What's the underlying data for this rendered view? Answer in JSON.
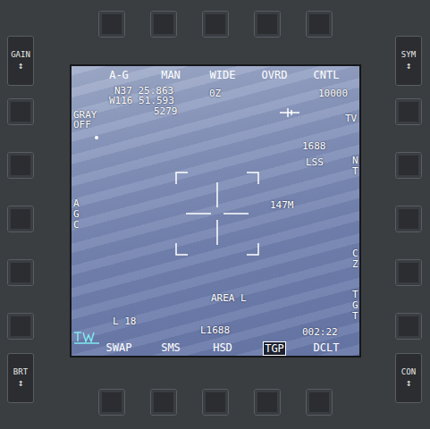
{
  "rockers": {
    "left": [
      {
        "label": "GAIN",
        "arrow": "↕"
      },
      {
        "label": "BRT",
        "arrow": "↕"
      }
    ],
    "right": [
      {
        "label": "SYM",
        "arrow": "↕"
      },
      {
        "label": "CON",
        "arrow": "↕"
      }
    ]
  },
  "top_options": [
    {
      "label": "A-G",
      "selected": false
    },
    {
      "label": "MAN",
      "selected": false
    },
    {
      "label": "WIDE",
      "selected": false
    },
    {
      "label": "OVRD",
      "selected": false
    },
    {
      "label": "CNTL",
      "selected": false
    }
  ],
  "bottom_options": [
    {
      "label": "SWAP",
      "selected": false
    },
    {
      "label": "SMS",
      "selected": false
    },
    {
      "label": "HSD",
      "selected": false
    },
    {
      "label": "TGP",
      "selected": true
    },
    {
      "label": "DCLT",
      "selected": false
    }
  ],
  "readouts": {
    "latitude": "N37 25.863",
    "longitude": "W116 51.593",
    "elevation": "5279",
    "time_zone": "0Z",
    "altitude": "10000",
    "gray": "GRAY",
    "gray_state": "OFF",
    "mode": "TV",
    "laser_code": "1688",
    "laser_label": "LSS",
    "nt": "NT",
    "agc": "AGC",
    "range": "147M",
    "cz": "CZ",
    "tgt": "TGT",
    "track": "AREA L",
    "laser_count": "L 18",
    "laser_code_lower": "L1688",
    "timer": "002:22"
  }
}
